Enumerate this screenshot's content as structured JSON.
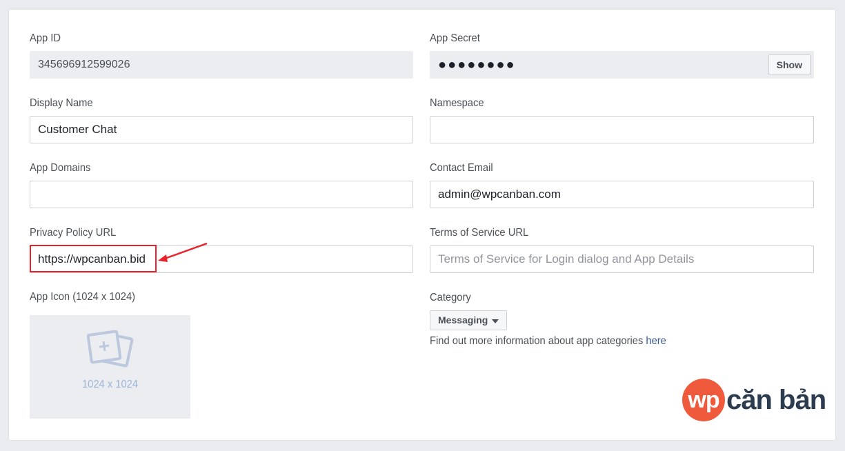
{
  "fields": {
    "app_id": {
      "label": "App ID",
      "value": "345696912599026"
    },
    "app_secret": {
      "label": "App Secret",
      "value": "●●●●●●●●",
      "show_label": "Show"
    },
    "display_name": {
      "label": "Display Name",
      "value": "Customer Chat"
    },
    "namespace": {
      "label": "Namespace",
      "value": ""
    },
    "app_domains": {
      "label": "App Domains",
      "value": ""
    },
    "contact_email": {
      "label": "Contact Email",
      "value": "admin@wpcanban.com"
    },
    "privacy_policy_url": {
      "label": "Privacy Policy URL",
      "value": "https://wpcanban.bid"
    },
    "terms_of_service_url": {
      "label": "Terms of Service URL",
      "placeholder": "Terms of Service for Login dialog and App Details"
    }
  },
  "app_icon": {
    "label": "App Icon (1024 x 1024)",
    "size_text": "1024 x 1024"
  },
  "category": {
    "label": "Category",
    "selected": "Messaging",
    "info_text": "Find out more information about app categories ",
    "info_link": "here"
  },
  "watermark": {
    "circle_text": "wp",
    "text": "căn bản"
  },
  "colors": {
    "background": "#e9ebee",
    "highlight": "#e8212b",
    "link": "#365899",
    "logo_accent": "#f05a3c"
  },
  "icons": [
    "add-photo-icon",
    "caret-down-icon",
    "annotation-arrow-icon"
  ]
}
